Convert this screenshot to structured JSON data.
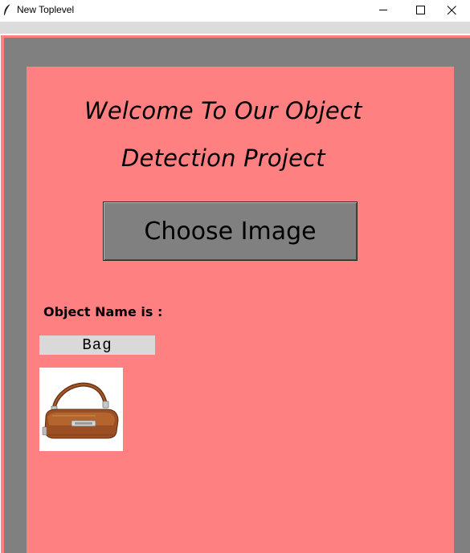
{
  "window": {
    "title": "New Toplevel",
    "controls": [
      "minimize-icon",
      "maximize-icon",
      "close-icon"
    ]
  },
  "colors": {
    "panel_bg": "#ff8080",
    "border_gray": "#808080",
    "button_bg": "#808080",
    "value_bg": "#d9d9d9",
    "menubar_bg": "#dcdcdc"
  },
  "main": {
    "heading_line1": "Welcome To Our Object",
    "heading_line2": "Detection Project",
    "choose_button_label": "Choose Image",
    "object_label": "Object Name is :",
    "object_value": "Bag",
    "preview_image": "handbag-photo"
  }
}
